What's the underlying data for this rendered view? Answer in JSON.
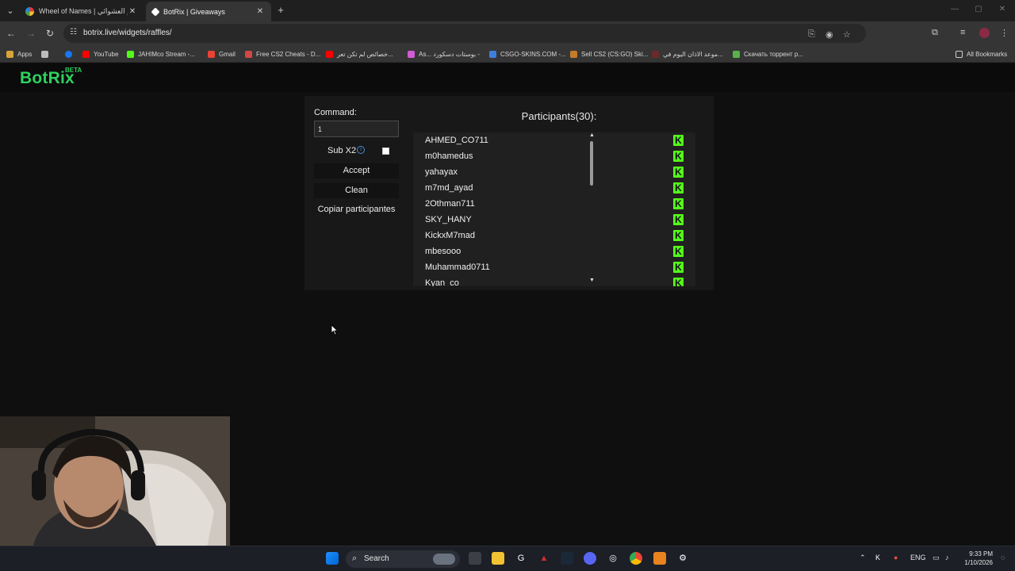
{
  "browser": {
    "tabs": [
      {
        "title": "Wheel of Names | تيم العشوائي",
        "active": false,
        "favicon_color": "#3aa1ff"
      },
      {
        "title": "BotRix | Giveaways",
        "active": true,
        "favicon_color": "#ffffff"
      }
    ],
    "new_tab": "+",
    "url": "botrix.live/widgets/raffles/",
    "bookmarks": [
      {
        "label": "Apps",
        "icon": "apps-grid-icon",
        "color": "#d9a53a"
      },
      {
        "label": "",
        "icon": "grid-icon",
        "color": "#bdbdbd"
      },
      {
        "label": "",
        "icon": "facebook-icon",
        "color": "#1877f2"
      },
      {
        "label": "YouTube",
        "icon": "youtube-icon",
        "color": "#ff0000"
      },
      {
        "label": "JAHIMco Stream -...",
        "icon": "kick-icon",
        "color": "#53fc18"
      },
      {
        "label": "Gmail",
        "icon": "gmail-icon",
        "color": "#ea4335"
      },
      {
        "label": "Free CS2 Cheats - D...",
        "icon": "site-icon",
        "color": "#d04848"
      },
      {
        "label": "خصائص لم تكن تعر...",
        "icon": "youtube-icon",
        "color": "#ff0000"
      },
      {
        "label": "As... بوستات دسكورد -",
        "icon": "heart-icon",
        "color": "#d25bd6"
      },
      {
        "label": "CSGO-SKINS.COM -...",
        "icon": "site-icon",
        "color": "#3f7fdc"
      },
      {
        "label": "Sell CS2 (CS:GO) Ski...",
        "icon": "site-icon",
        "color": "#c47a2a"
      },
      {
        "label": "موعد الاذان اليوم في...",
        "icon": "site-icon",
        "color": "#6b2a2a"
      },
      {
        "label": "Скачать торрент р...",
        "icon": "site-icon",
        "color": "#5ab34a"
      }
    ],
    "all_bookmarks": "All Bookmarks"
  },
  "site": {
    "logo": "BotRix",
    "beta": "BETA"
  },
  "widget": {
    "command_label": "Command:",
    "command_value": "1",
    "sub_x2_label": "Sub X2",
    "sub_x2_checked": false,
    "accept_label": "Accept",
    "clean_label": "Clean",
    "copy_label": "Copiar participantes",
    "participants_title": "Participants(30):",
    "participants": [
      "AHMED_CO711",
      "m0hamedus",
      "yahayax",
      "m7md_ayad",
      "2Othman711",
      "SKY_HANY",
      "KickxM7mad",
      "mbesooo",
      "Muhammad0711",
      "Kyan_co"
    ],
    "platform_badge": "K",
    "platform_color": "#53fc18"
  },
  "taskbar": {
    "search_label": "Search",
    "tray_lang": "ENG",
    "time": "9:33 PM",
    "date": "1/10/2026"
  }
}
